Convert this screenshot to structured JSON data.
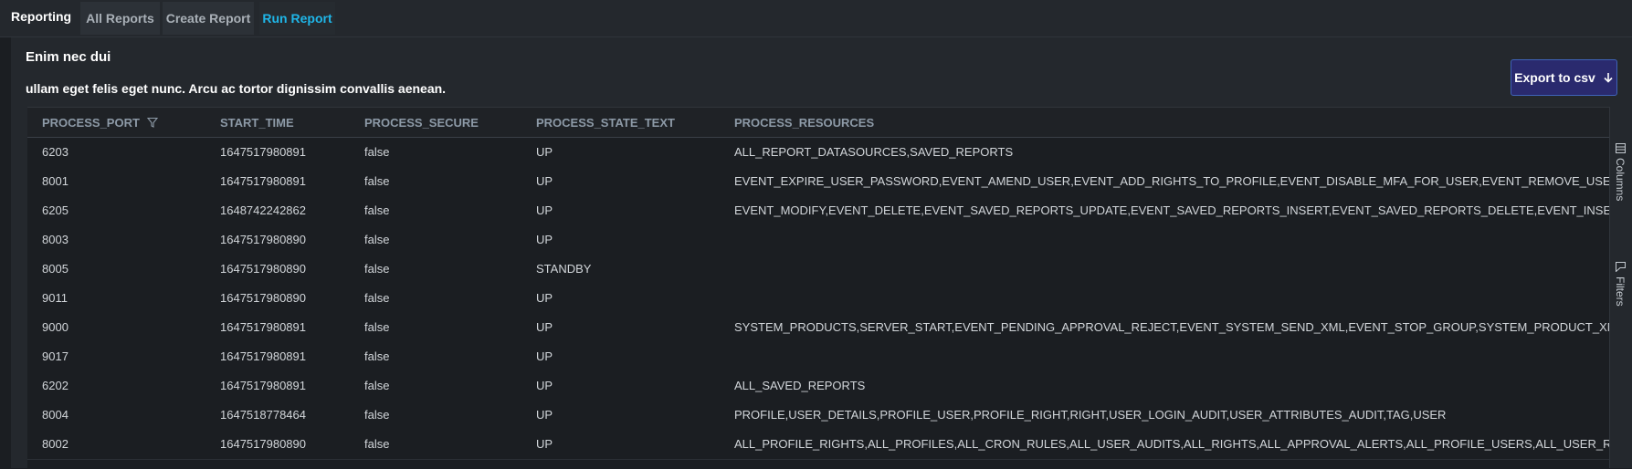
{
  "app": {
    "title": "Reporting"
  },
  "tabs": [
    {
      "label": "All Reports",
      "active": false
    },
    {
      "label": "Create Report",
      "active": false
    },
    {
      "label": "Run Report",
      "active": true
    }
  ],
  "report": {
    "title": "Enim nec dui",
    "description": "ullam eget felis eget nunc. Arcu ac tortor dignissim convallis aenean."
  },
  "toolbar": {
    "export_label": "Export to csv",
    "export_icon": "arrow-down-icon"
  },
  "table": {
    "columns": [
      "PROCESS_PORT",
      "START_TIME",
      "PROCESS_SECURE",
      "PROCESS_STATE_TEXT",
      "PROCESS_RESOURCES"
    ],
    "rows": [
      [
        "6203",
        "1647517980891",
        "false",
        "UP",
        "ALL_REPORT_DATASOURCES,SAVED_REPORTS"
      ],
      [
        "8001",
        "1647517980891",
        "false",
        "UP",
        "EVENT_EXPIRE_USER_PASSWORD,EVENT_AMEND_USER,EVENT_ADD_RIGHTS_TO_PROFILE,EVENT_DISABLE_MFA_FOR_USER,EVENT_REMOVE_USERS"
      ],
      [
        "6205",
        "1648742242862",
        "false",
        "UP",
        "EVENT_MODIFY,EVENT_DELETE,EVENT_SAVED_REPORTS_UPDATE,EVENT_SAVED_REPORTS_INSERT,EVENT_SAVED_REPORTS_DELETE,EVENT_INSERT"
      ],
      [
        "8003",
        "1647517980890",
        "false",
        "UP",
        ""
      ],
      [
        "8005",
        "1647517980890",
        "false",
        "STANDBY",
        ""
      ],
      [
        "9011",
        "1647517980890",
        "false",
        "UP",
        ""
      ],
      [
        "9000",
        "1647517980891",
        "false",
        "UP",
        "SYSTEM_PRODUCTS,SERVER_START,EVENT_PENDING_APPROVAL_REJECT,EVENT_SYSTEM_SEND_XML,EVENT_STOP_GROUP,SYSTEM_PRODUCT_XM"
      ],
      [
        "9017",
        "1647517980891",
        "false",
        "UP",
        ""
      ],
      [
        "6202",
        "1647517980891",
        "false",
        "UP",
        "ALL_SAVED_REPORTS"
      ],
      [
        "8004",
        "1647518778464",
        "false",
        "UP",
        "PROFILE,USER_DETAILS,PROFILE_USER,PROFILE_RIGHT,RIGHT,USER_LOGIN_AUDIT,USER_ATTRIBUTES_AUDIT,TAG,USER"
      ],
      [
        "8002",
        "1647517980890",
        "false",
        "UP",
        "ALL_PROFILE_RIGHTS,ALL_PROFILES,ALL_CRON_RULES,ALL_USER_AUDITS,ALL_RIGHTS,ALL_APPROVAL_ALERTS,ALL_PROFILE_USERS,ALL_USER_RIG"
      ]
    ]
  },
  "side_panel": {
    "columns_label": "Columns",
    "filters_label": "Filters"
  },
  "colors": {
    "accent": "#1fb6e8",
    "export_bg": "#2a2a6e",
    "background": "#1b1e22"
  }
}
